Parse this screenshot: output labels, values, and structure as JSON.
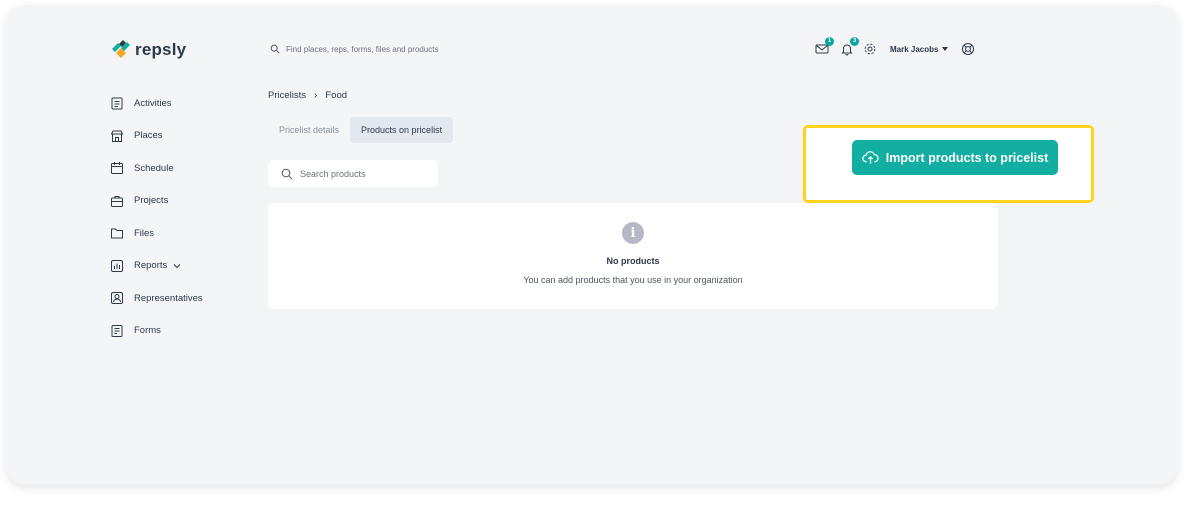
{
  "brand": {
    "name": "repsly",
    "colors": {
      "teal": "#12aea1",
      "yellow": "#ffd21f",
      "orange": "#f5a623",
      "navy": "#2d3a4a"
    }
  },
  "header": {
    "search_text": "Find places, reps, forms, files and products",
    "messages_badge": "1",
    "notifications_badge": "3",
    "user_name": "Mark Jacobs",
    "icons": [
      "envelope-icon",
      "bell-icon",
      "gear-icon",
      "help-lifebuoy-icon"
    ]
  },
  "sidebar": {
    "items": [
      {
        "label": "Activities",
        "icon": "clipboard-icon"
      },
      {
        "label": "Places",
        "icon": "store-icon"
      },
      {
        "label": "Schedule",
        "icon": "calendar-icon"
      },
      {
        "label": "Projects",
        "icon": "briefcase-icon"
      },
      {
        "label": "Files",
        "icon": "folder-icon"
      },
      {
        "label": "Reports",
        "icon": "chart-icon"
      },
      {
        "label": "Representatives",
        "icon": "person-badge-icon"
      },
      {
        "label": "Forms",
        "icon": "form-icon"
      }
    ]
  },
  "breadcrumb": {
    "parent": "Pricelists",
    "current": "Food"
  },
  "tabs": [
    {
      "label": "Pricelist details",
      "active": false
    },
    {
      "label": "Products on pricelist",
      "active": true
    }
  ],
  "product_search": {
    "placeholder": "Search products"
  },
  "empty_state": {
    "title": "No products",
    "subtitle": "You can add products that you use in your organization"
  },
  "import_button": {
    "label": "Import products to pricelist"
  }
}
